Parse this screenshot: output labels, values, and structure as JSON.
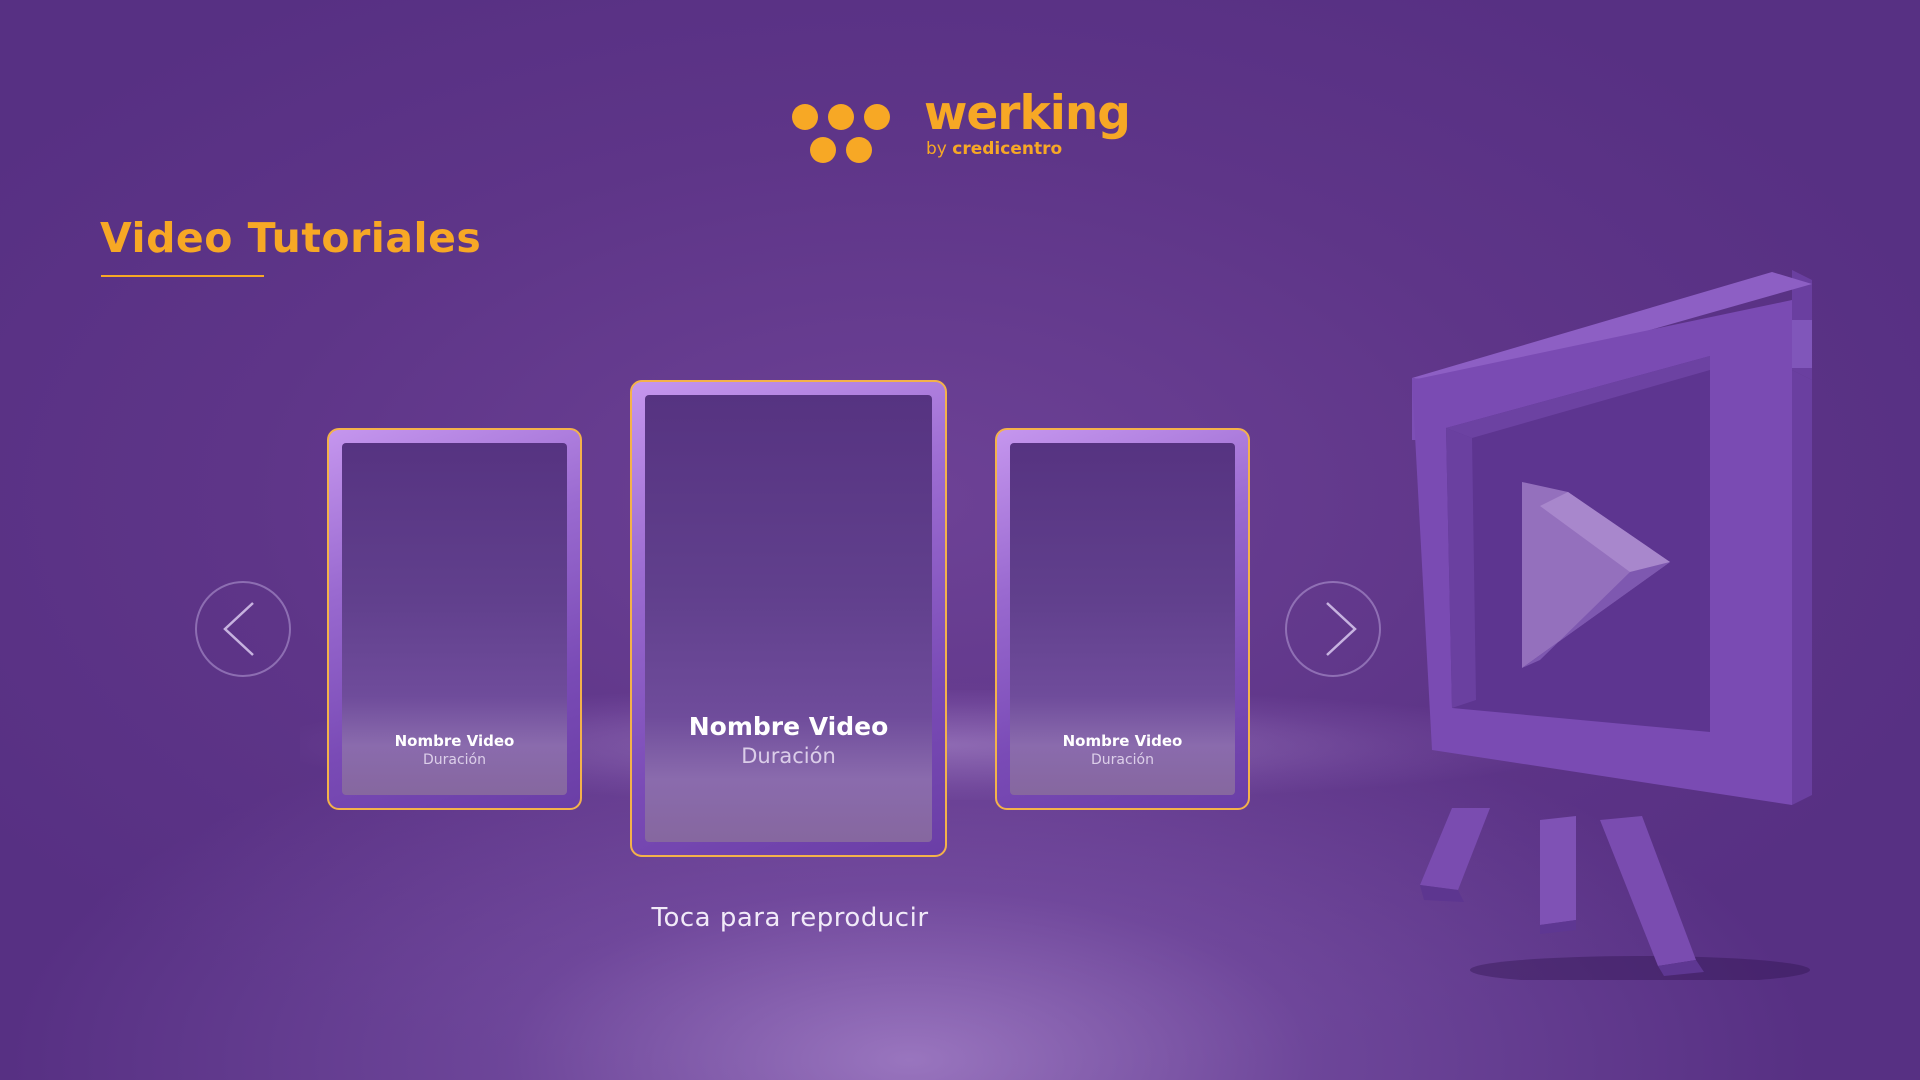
{
  "brand": {
    "wordmark": "werking",
    "sub_prefix": "by",
    "sub_name": "credicentro",
    "color": "#f7a825"
  },
  "section": {
    "title": "Video Tutoriales"
  },
  "carousel": {
    "prev_icon": "chevron-left-icon",
    "next_icon": "chevron-right-icon",
    "cards": [
      {
        "name": "Nombre Video",
        "duration": "Duración"
      },
      {
        "name": "Nombre Video",
        "duration": "Duración"
      },
      {
        "name": "Nombre Video",
        "duration": "Duración"
      }
    ],
    "hint": "Toca para reproducir"
  },
  "decoration": {
    "icon": "play-screen-icon"
  },
  "colors": {
    "background": "#5e3588",
    "accent": "#f7a825",
    "card_border": "#f4b24a"
  }
}
